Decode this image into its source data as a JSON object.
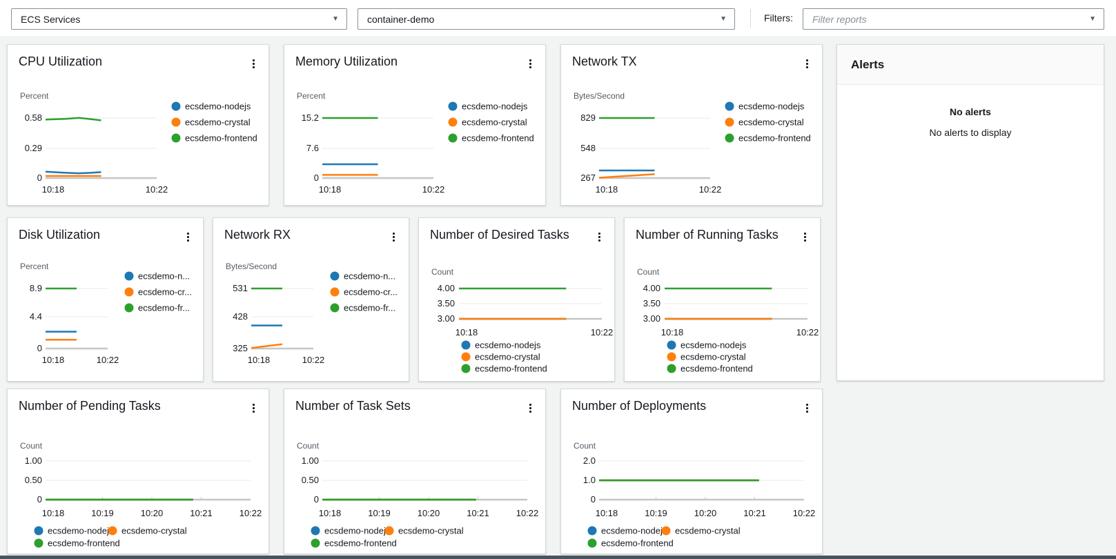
{
  "topbar": {
    "report_type_value": "ECS Services",
    "resource_value": "container-demo",
    "filters_label": "Filters:",
    "filter_placeholder": "Filter reports"
  },
  "palette": {
    "nodejs": "#1f77b4",
    "crystal": "#ff7f0e",
    "frontend": "#2ca02c"
  },
  "alerts_panel": {
    "title": "Alerts",
    "empty_heading": "No alerts",
    "empty_message": "No alerts to display"
  },
  "charts": [
    {
      "id": "cpu-utilization",
      "title": "CPU Utilization",
      "type": "line",
      "unit": "Percent",
      "y_ticks": [
        "0.58",
        "0.29",
        "0"
      ],
      "x_ticks": [
        "10:18",
        "10:22"
      ],
      "x_axis": {
        "start": "10:18",
        "end": "10:22"
      },
      "legend_labels": [
        "ecsdemo-nodejs",
        "ecsdemo-crystal",
        "ecsdemo-frontend"
      ],
      "series": [
        {
          "name": "ecsdemo-nodejs",
          "color": "#1f77b4",
          "points": [
            [
              0,
              0.062
            ],
            [
              0.15,
              0.053
            ],
            [
              0.3,
              0.046
            ],
            [
              0.42,
              0.051
            ],
            [
              0.5,
              0.057
            ]
          ]
        },
        {
          "name": "ecsdemo-crystal",
          "color": "#ff7f0e",
          "points": [
            [
              0,
              0.02
            ],
            [
              0.5,
              0.02
            ]
          ]
        },
        {
          "name": "ecsdemo-frontend",
          "color": "#2ca02c",
          "points": [
            [
              0,
              0.565
            ],
            [
              0.18,
              0.572
            ],
            [
              0.3,
              0.582
            ],
            [
              0.5,
              0.557
            ]
          ]
        }
      ]
    },
    {
      "id": "memory-utilization",
      "title": "Memory Utilization",
      "type": "line",
      "unit": "Percent",
      "y_ticks": [
        "15.2",
        "7.6",
        "0"
      ],
      "x_ticks": [
        "10:18",
        "10:22"
      ],
      "x_axis": {
        "start": "10:18",
        "end": "10:22"
      },
      "legend_labels": [
        "ecsdemo-nodejs",
        "ecsdemo-crystal",
        "ecsdemo-frontend"
      ],
      "series": [
        {
          "name": "ecsdemo-nodejs",
          "color": "#1f77b4",
          "points": [
            [
              0,
              3.5
            ],
            [
              0.5,
              3.5
            ]
          ]
        },
        {
          "name": "ecsdemo-crystal",
          "color": "#ff7f0e",
          "points": [
            [
              0,
              0.8
            ],
            [
              0.5,
              0.8
            ]
          ]
        },
        {
          "name": "ecsdemo-frontend",
          "color": "#2ca02c",
          "points": [
            [
              0,
              15.2
            ],
            [
              0.5,
              15.2
            ]
          ]
        }
      ]
    },
    {
      "id": "network-tx",
      "title": "Network TX",
      "type": "line",
      "unit": "Bytes/Second",
      "y_ticks": [
        "829",
        "548",
        "267"
      ],
      "x_ticks": [
        "10:18",
        "10:22"
      ],
      "x_axis": {
        "start": "10:18",
        "end": "10:22"
      },
      "legend_labels": [
        "ecsdemo-nodejs",
        "ecsdemo-crystal",
        "ecsdemo-frontend"
      ],
      "series": [
        {
          "name": "ecsdemo-nodejs",
          "color": "#1f77b4",
          "points": [
            [
              0,
              338
            ],
            [
              0.5,
              338
            ]
          ]
        },
        {
          "name": "ecsdemo-crystal",
          "color": "#ff7f0e",
          "points": [
            [
              0,
              270
            ],
            [
              0.5,
              303
            ]
          ]
        },
        {
          "name": "ecsdemo-frontend",
          "color": "#2ca02c",
          "points": [
            [
              0,
              829
            ],
            [
              0.5,
              829
            ]
          ]
        }
      ]
    },
    {
      "id": "disk-utilization",
      "title": "Disk Utilization",
      "type": "line",
      "unit": "Percent",
      "y_ticks": [
        "8.9",
        "4.4",
        "0"
      ],
      "x_ticks": [
        "10:18",
        "10:22"
      ],
      "x_axis": {
        "start": "10:18",
        "end": "10:22"
      },
      "legend_labels": [
        "ecsdemo-n...",
        "ecsdemo-cr...",
        "ecsdemo-fr..."
      ],
      "series": [
        {
          "name": "ecsdemo-nodejs",
          "color": "#1f77b4",
          "points": [
            [
              0,
              2.5
            ],
            [
              0.5,
              2.5
            ]
          ]
        },
        {
          "name": "ecsdemo-crystal",
          "color": "#ff7f0e",
          "points": [
            [
              0,
              1.3
            ],
            [
              0.5,
              1.3
            ]
          ]
        },
        {
          "name": "ecsdemo-frontend",
          "color": "#2ca02c",
          "points": [
            [
              0,
              8.9
            ],
            [
              0.5,
              8.9
            ]
          ]
        }
      ]
    },
    {
      "id": "network-rx",
      "title": "Network RX",
      "type": "line",
      "unit": "Bytes/Second",
      "y_ticks": [
        "531",
        "428",
        "325"
      ],
      "x_ticks": [
        "10:18",
        "10:22"
      ],
      "x_axis": {
        "start": "10:18",
        "end": "10:22"
      },
      "legend_labels": [
        "ecsdemo-n...",
        "ecsdemo-cr...",
        "ecsdemo-fr..."
      ],
      "series": [
        {
          "name": "ecsdemo-nodejs",
          "color": "#1f77b4",
          "points": [
            [
              0,
              404
            ],
            [
              0.5,
              404
            ]
          ]
        },
        {
          "name": "ecsdemo-crystal",
          "color": "#ff7f0e",
          "points": [
            [
              0,
              327
            ],
            [
              0.5,
              340
            ]
          ]
        },
        {
          "name": "ecsdemo-frontend",
          "color": "#2ca02c",
          "points": [
            [
              0,
              531
            ],
            [
              0.5,
              531
            ]
          ]
        }
      ]
    },
    {
      "id": "desired-tasks",
      "title": "Number of Desired Tasks",
      "type": "line",
      "unit": "Count",
      "y_ticks": [
        "4.00",
        "3.50",
        "3.00"
      ],
      "x_ticks": [
        "10:18",
        "10:22"
      ],
      "x_axis": {
        "start": "10:18",
        "end": "10:22"
      },
      "legend_labels": [
        "ecsdemo-nodejs",
        "ecsdemo-crystal",
        "ecsdemo-frontend"
      ],
      "series": [
        {
          "name": "ecsdemo-nodejs",
          "color": "#1f77b4",
          "points": [
            [
              0,
              3
            ],
            [
              0.75,
              3
            ]
          ]
        },
        {
          "name": "ecsdemo-crystal",
          "color": "#ff7f0e",
          "points": [
            [
              0,
              3
            ],
            [
              0.75,
              3
            ]
          ]
        },
        {
          "name": "ecsdemo-frontend",
          "color": "#2ca02c",
          "points": [
            [
              0,
              4
            ],
            [
              0.75,
              4
            ]
          ]
        }
      ]
    },
    {
      "id": "running-tasks",
      "title": "Number of Running Tasks",
      "type": "line",
      "unit": "Count",
      "y_ticks": [
        "4.00",
        "3.50",
        "3.00"
      ],
      "x_ticks": [
        "10:18",
        "10:22"
      ],
      "x_axis": {
        "start": "10:18",
        "end": "10:22"
      },
      "legend_labels": [
        "ecsdemo-nodejs",
        "ecsdemo-crystal",
        "ecsdemo-frontend"
      ],
      "series": [
        {
          "name": "ecsdemo-nodejs",
          "color": "#1f77b4",
          "points": [
            [
              0,
              3
            ],
            [
              0.75,
              3
            ]
          ]
        },
        {
          "name": "ecsdemo-crystal",
          "color": "#ff7f0e",
          "points": [
            [
              0,
              3
            ],
            [
              0.75,
              3
            ]
          ]
        },
        {
          "name": "ecsdemo-frontend",
          "color": "#2ca02c",
          "points": [
            [
              0,
              4
            ],
            [
              0.75,
              4
            ]
          ]
        }
      ]
    },
    {
      "id": "pending-tasks",
      "title": "Number of Pending Tasks",
      "type": "line",
      "unit": "Count",
      "y_ticks": [
        "1.00",
        "0.50",
        "0"
      ],
      "x_ticks": [
        "10:18",
        "10:19",
        "10:20",
        "10:21",
        "10:22"
      ],
      "x_axis": {
        "start": "10:18",
        "end": "10:22"
      },
      "legend_labels": [
        "ecsdemo-nodejs",
        "ecsdemo-crystal",
        "ecsdemo-frontend"
      ],
      "series": [
        {
          "name": "ecsdemo-nodejs",
          "color": "#1f77b4",
          "points": [
            [
              0,
              0
            ],
            [
              0.72,
              0
            ]
          ]
        },
        {
          "name": "ecsdemo-crystal",
          "color": "#ff7f0e",
          "points": [
            [
              0,
              0
            ],
            [
              0.72,
              0
            ]
          ]
        },
        {
          "name": "ecsdemo-frontend",
          "color": "#2ca02c",
          "points": [
            [
              0,
              0
            ],
            [
              0.72,
              0
            ]
          ]
        }
      ]
    },
    {
      "id": "task-sets",
      "title": "Number of Task Sets",
      "type": "line",
      "unit": "Count",
      "y_ticks": [
        "1.00",
        "0.50",
        "0"
      ],
      "x_ticks": [
        "10:18",
        "10:19",
        "10:20",
        "10:21",
        "10:22"
      ],
      "x_axis": {
        "start": "10:18",
        "end": "10:22"
      },
      "legend_labels": [
        "ecsdemo-nodejs",
        "ecsdemo-crystal",
        "ecsdemo-frontend"
      ],
      "series": [
        {
          "name": "ecsdemo-nodejs",
          "color": "#1f77b4",
          "points": [
            [
              0,
              0
            ],
            [
              0.75,
              0
            ]
          ]
        },
        {
          "name": "ecsdemo-crystal",
          "color": "#ff7f0e",
          "points": [
            [
              0,
              0
            ],
            [
              0.75,
              0
            ]
          ]
        },
        {
          "name": "ecsdemo-frontend",
          "color": "#2ca02c",
          "points": [
            [
              0,
              0
            ],
            [
              0.75,
              0
            ]
          ]
        }
      ]
    },
    {
      "id": "deployments",
      "title": "Number of Deployments",
      "type": "line",
      "unit": "Count",
      "y_ticks": [
        "2.0",
        "1.0",
        "0"
      ],
      "x_ticks": [
        "10:18",
        "10:19",
        "10:20",
        "10:21",
        "10:22"
      ],
      "x_axis": {
        "start": "10:18",
        "end": "10:22"
      },
      "legend_labels": [
        "ecsdemo-nodejs",
        "ecsdemo-crystal",
        "ecsdemo-frontend"
      ],
      "series": [
        {
          "name": "ecsdemo-nodejs",
          "color": "#1f77b4",
          "points": [
            [
              0,
              1
            ],
            [
              0.78,
              1
            ]
          ]
        },
        {
          "name": "ecsdemo-crystal",
          "color": "#ff7f0e",
          "points": [
            [
              0,
              1
            ],
            [
              0.78,
              1
            ]
          ]
        },
        {
          "name": "ecsdemo-frontend",
          "color": "#2ca02c",
          "points": [
            [
              0,
              1
            ],
            [
              0.78,
              1
            ]
          ]
        }
      ]
    }
  ]
}
